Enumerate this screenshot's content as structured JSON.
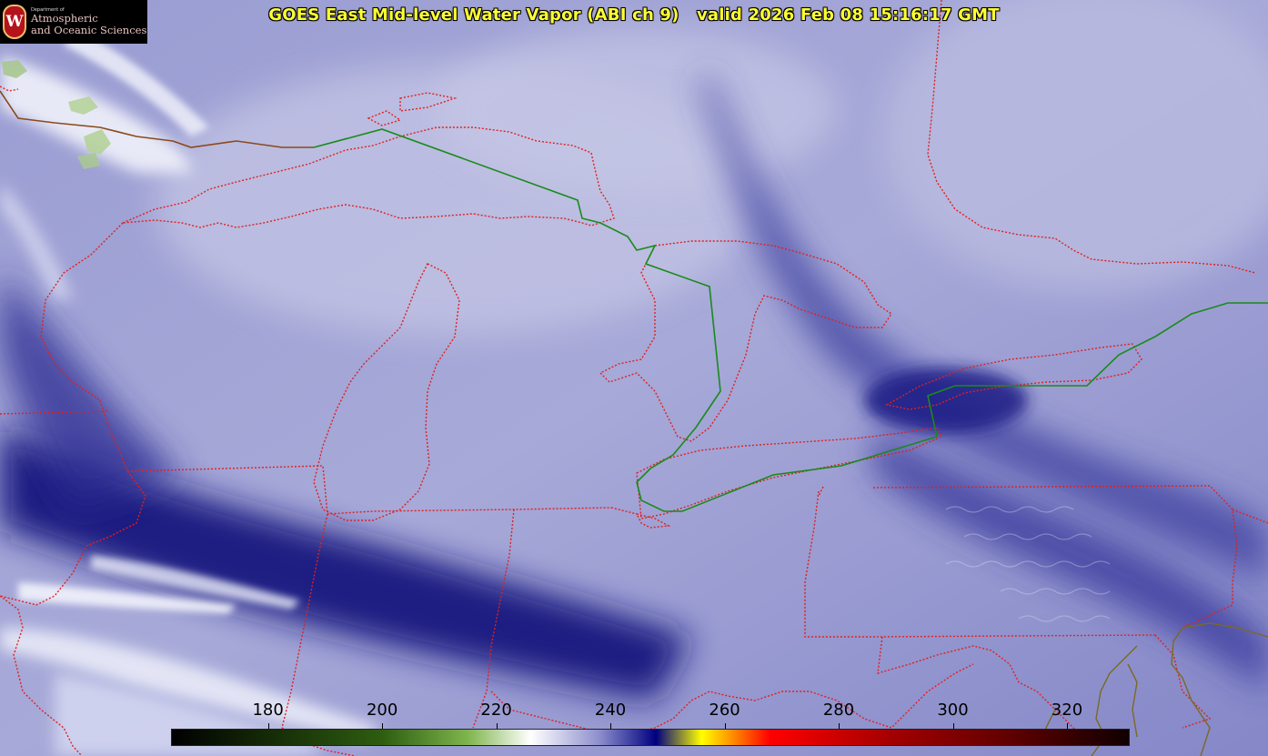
{
  "header": {
    "title_main": "GOES East Mid-level Water Vapor (ABI ch 9)",
    "title_valid": "valid 2026 Feb 08 15:16:17 GMT"
  },
  "logo": {
    "seal_letter": "W",
    "dept": "Department of",
    "line1": "Atmospheric",
    "line2": "and Oceanic Sciences"
  },
  "colorbar": {
    "ticks": [
      "180",
      "200",
      "220",
      "240",
      "260",
      "280",
      "300",
      "320"
    ],
    "tick_values": [
      180,
      200,
      220,
      240,
      260,
      280,
      300,
      320
    ],
    "range": [
      163,
      331
    ],
    "stops": [
      {
        "value": 163,
        "color": "#000000"
      },
      {
        "value": 200,
        "color": "#2e5d10"
      },
      {
        "value": 215,
        "color": "#7fb54d"
      },
      {
        "value": 226,
        "color": "#ffffff"
      },
      {
        "value": 238,
        "color": "#8d8fcc"
      },
      {
        "value": 248,
        "color": "#000080"
      },
      {
        "value": 256,
        "color": "#ffff00"
      },
      {
        "value": 262,
        "color": "#ff8000"
      },
      {
        "value": 268,
        "color": "#ff0000"
      },
      {
        "value": 290,
        "color": "#a00000"
      },
      {
        "value": 310,
        "color": "#600000"
      },
      {
        "value": 331,
        "color": "#100000"
      }
    ]
  },
  "colors": {
    "state_borders": "#e02020",
    "coastlines": "#e02020",
    "international_border": "#008000",
    "title_text": "#ffff33"
  }
}
